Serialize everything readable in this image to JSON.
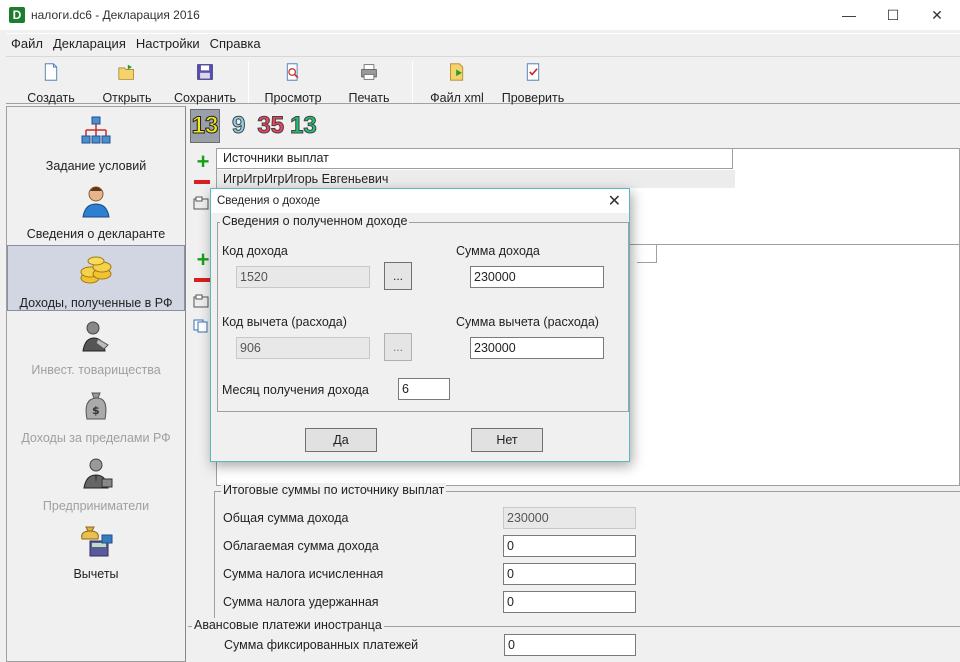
{
  "window": {
    "title": "налоги.dc6 - Декларация 2016",
    "icon_letter": "D",
    "minimize_glyph": "—",
    "maximize_glyph": "☐",
    "close_glyph": "✕"
  },
  "menu": [
    "Файл",
    "Декларация",
    "Настройки",
    "Справка"
  ],
  "toolbar": {
    "create": "Создать",
    "open": "Открыть",
    "save": "Сохранить",
    "preview": "Просмотр",
    "print": "Печать",
    "xml": "Файл xml",
    "check": "Проверить"
  },
  "sidebar": {
    "items": [
      {
        "label": "Задание условий",
        "icon": "flowchart-icon"
      },
      {
        "label": "Сведения о декларанте",
        "icon": "person-icon"
      },
      {
        "label": "Доходы, полученные в РФ",
        "icon": "coins-icon"
      },
      {
        "label": "Инвест. товарищества",
        "icon": "handshake-icon"
      },
      {
        "label": "Доходы за пределами РФ",
        "icon": "money-bag-icon"
      },
      {
        "label": "Предприниматели",
        "icon": "businessman-icon"
      },
      {
        "label": "Вычеты",
        "icon": "calculator-icon"
      }
    ],
    "active_index": 2
  },
  "rates": {
    "r1": "13",
    "r2": "9",
    "r3": "35",
    "r4": "13"
  },
  "sources_table": {
    "header": "Источники выплат",
    "rows": [
      "ИгрИгрИгрИгорь Евгеньевич"
    ]
  },
  "totals": {
    "title": "Итоговые суммы по источнику выплат",
    "total_income_label": "Общая сумма дохода",
    "total_income_value": "230000",
    "taxable_label": "Облагаемая сумма дохода",
    "taxable_value": "0",
    "tax_calc_label": "Сумма налога исчисленная",
    "tax_calc_value": "0",
    "tax_withheld_label": "Сумма налога удержанная",
    "tax_withheld_value": "0"
  },
  "advance": {
    "title": "Авансовые платежи иностранца",
    "fixed_label": "Сумма фиксированных платежей",
    "fixed_value": "0"
  },
  "dialog": {
    "title": "Сведения о доходе",
    "close_glyph": "✕",
    "group_title": "Сведения о полученном доходе",
    "income_code_label": "Код дохода",
    "income_code_value": "1520",
    "income_sum_label": "Сумма дохода",
    "income_sum_value": "230000",
    "deduction_code_label": "Код вычета (расхода)",
    "deduction_code_value": "906",
    "deduction_sum_label": "Сумма вычета (расхода)",
    "deduction_sum_value": "230000",
    "month_label": "Месяц получения дохода",
    "month_value": "6",
    "ellipsis": "...",
    "yes": "Да",
    "no": "Нет"
  }
}
